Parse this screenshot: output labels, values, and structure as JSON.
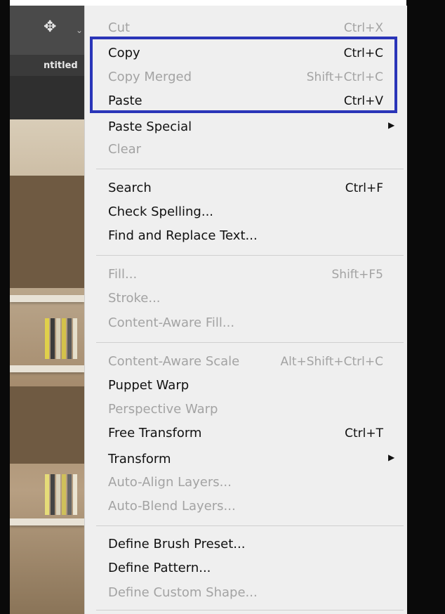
{
  "app": {
    "tab_label": "ntitled",
    "move_tool_icon": "move-tool-icon"
  },
  "menu": {
    "items": [
      {
        "label": "Cut",
        "shortcut": "Ctrl+X",
        "enabled": false
      },
      {
        "label": "Copy",
        "shortcut": "Ctrl+C",
        "enabled": true
      },
      {
        "label": "Copy Merged",
        "shortcut": "Shift+Ctrl+C",
        "enabled": false
      },
      {
        "label": "Paste",
        "shortcut": "Ctrl+V",
        "enabled": true
      },
      {
        "label": "Paste Special",
        "shortcut": "",
        "enabled": true,
        "submenu": true
      },
      {
        "label": "Clear",
        "shortcut": "",
        "enabled": false
      },
      {
        "label": "Search",
        "shortcut": "Ctrl+F",
        "enabled": true
      },
      {
        "label": "Check Spelling...",
        "shortcut": "",
        "enabled": true
      },
      {
        "label": "Find and Replace Text...",
        "shortcut": "",
        "enabled": true
      },
      {
        "label": "Fill...",
        "shortcut": "Shift+F5",
        "enabled": false
      },
      {
        "label": "Stroke...",
        "shortcut": "",
        "enabled": false
      },
      {
        "label": "Content-Aware Fill...",
        "shortcut": "",
        "enabled": false
      },
      {
        "label": "Content-Aware Scale",
        "shortcut": "Alt+Shift+Ctrl+C",
        "enabled": false
      },
      {
        "label": "Puppet Warp",
        "shortcut": "",
        "enabled": true
      },
      {
        "label": "Perspective Warp",
        "shortcut": "",
        "enabled": false
      },
      {
        "label": "Free Transform",
        "shortcut": "Ctrl+T",
        "enabled": true
      },
      {
        "label": "Transform",
        "shortcut": "",
        "enabled": true,
        "submenu": true
      },
      {
        "label": "Auto-Align Layers...",
        "shortcut": "",
        "enabled": false
      },
      {
        "label": "Auto-Blend Layers...",
        "shortcut": "",
        "enabled": false
      },
      {
        "label": "Define Brush Preset...",
        "shortcut": "",
        "enabled": true
      },
      {
        "label": "Define Pattern...",
        "shortcut": "",
        "enabled": true
      },
      {
        "label": "Define Custom Shape...",
        "shortcut": "",
        "enabled": false
      }
    ]
  },
  "colors": {
    "highlight_border": "#2a35b8",
    "menu_bg": "#efefef",
    "enabled_text": "#111111",
    "disabled_text": "#a3a3a3"
  }
}
